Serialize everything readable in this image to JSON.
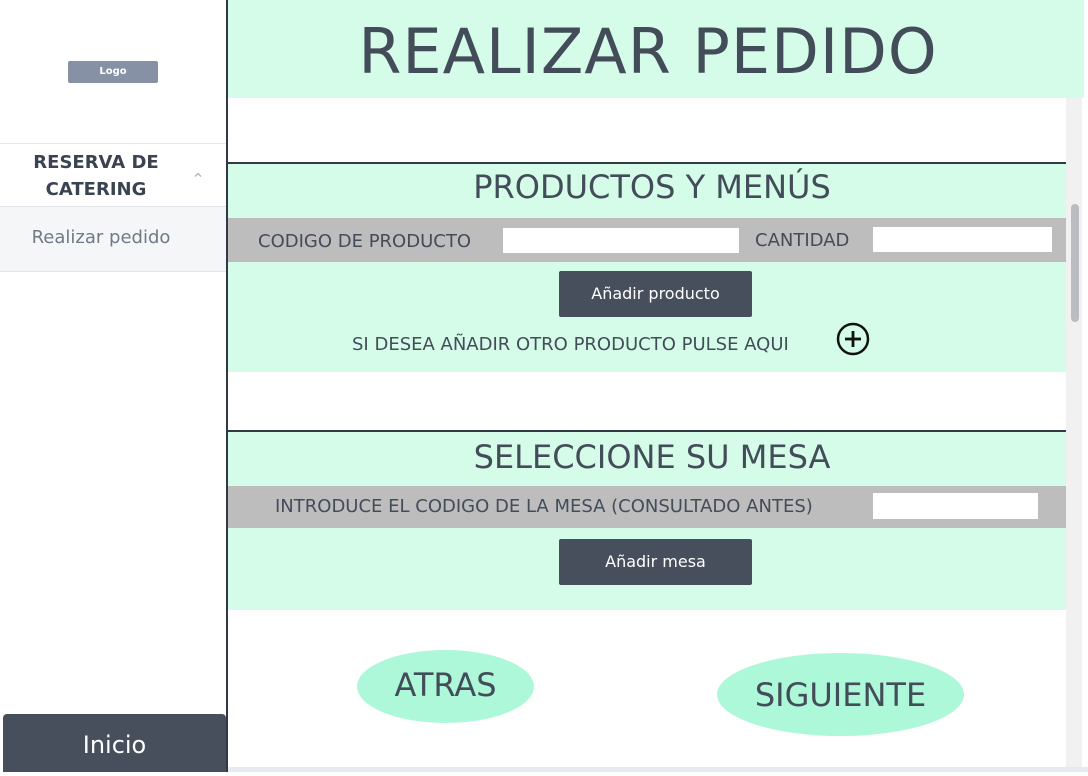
{
  "sidebar": {
    "logo": "Logo",
    "section_title": "RESERVA DE CATERING",
    "item_label": "Realizar pedido",
    "inicio_label": "Inicio"
  },
  "header": {
    "title": "REALIZAR PEDIDO"
  },
  "products": {
    "title": "PRODUCTOS Y MENÚS",
    "code_label": "CODIGO DE PRODUCTO",
    "code_value": "",
    "qty_label": "CANTIDAD",
    "qty_value": "",
    "add_button": "Añadir producto",
    "add_another_hint": "SI DESEA AÑADIR OTRO PRODUCTO PULSE AQUI"
  },
  "table": {
    "title": "SELECCIONE SU MESA",
    "code_label": "INTRODUCE EL CODIGO DE LA MESA (CONSULTADO ANTES)",
    "code_value": "",
    "add_button": "Añadir mesa"
  },
  "nav": {
    "back_label": "ATRAS",
    "next_label": "SIGUIENTE"
  },
  "colors": {
    "mint_band": "#d5fce8",
    "oval_button": "#aef8da",
    "dark_button": "#474f5c",
    "grey_row": "#bdbdbd",
    "text": "#434c59"
  },
  "icons": {
    "add_another": "plus-circle-icon",
    "collapse": "chevron-up-icon"
  }
}
